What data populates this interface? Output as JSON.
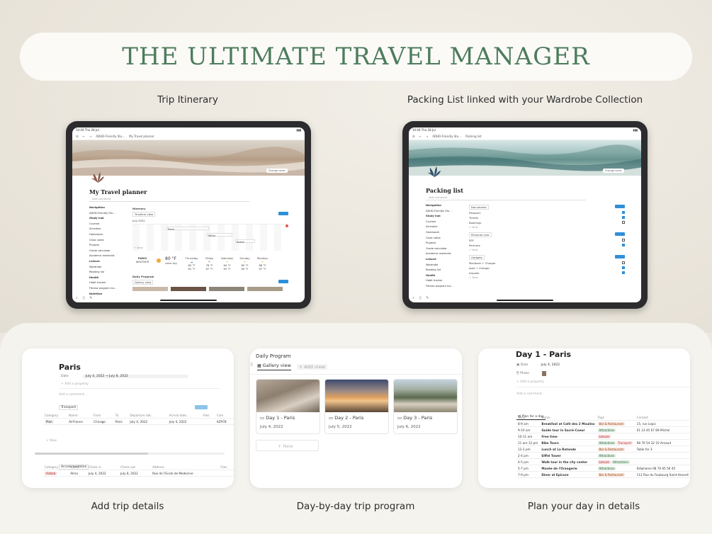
{
  "title": "THE ULTIMATE TRAVEL MANAGER",
  "captions": {
    "itinerary": "Trip Itinerary",
    "packing": "Packing List linked with your Wardrobe Collection",
    "trip_details": "Add trip details",
    "day_by_day": "Day-by-day trip program",
    "plan_day": "Plan your day in details"
  },
  "tablet_left": {
    "status_time": "10:04  Thu 28 Jul",
    "breadcrumb_1": "ADHD-Friendly Stu...",
    "breadcrumb_2": "My Travel planner",
    "change_cover": "Change cover",
    "page_title": "My Travel planner",
    "add_comment": "Add comment",
    "nav_heading": "Navigation",
    "nav_items": [
      "ADHD-Friendly Stu...",
      "Study hub",
      "Courses",
      "Schedule",
      "Homework",
      "Class notes",
      "Projects",
      "Grade calculator",
      "Academic materials",
      "Leisure",
      "Wardrobe",
      "Reading list",
      "Health",
      "Habit tracker",
      "Fitness program tra...",
      "Nutrition"
    ],
    "itinerary_label": "Itinerary",
    "timeline_view": "Timeline view",
    "month": "July 2022",
    "events": [
      "Paris",
      "Milan",
      "Rome"
    ],
    "new_label": "+ New",
    "weather_city": "PARIS",
    "weather_label": "WEATHER",
    "weather_temp": "80 °F",
    "weather_desc": "clear sky",
    "forecast": [
      {
        "day": "Thursday",
        "hi": "80 °F",
        "lo": "61 °F"
      },
      {
        "day": "Friday",
        "hi": "78 °F",
        "lo": "67 °F"
      },
      {
        "day": "Saturday",
        "hi": "84 °F",
        "lo": "63 °F"
      },
      {
        "day": "Sunday",
        "hi": "85 °F",
        "lo": "65 °F"
      },
      {
        "day": "Monday",
        "hi": "88 °F",
        "lo": "67 °F"
      }
    ],
    "daily_program": "Daily Program",
    "gallery_view": "Gallery view"
  },
  "tablet_right": {
    "status_time": "10:04  Thu 28 Jul",
    "breadcrumb_1": "ADHD-Friendly Stu...",
    "breadcrumb_2": "Packing list",
    "change_cover": "Change cover",
    "page_title": "Packing list",
    "add_comment": "Add comment",
    "nav_items": [
      "Navigation",
      "ADHD-Friendly Stu...",
      "Study hub",
      "Courses",
      "Schedule",
      "Homework",
      "Class notes",
      "Projects",
      "Grade calculator",
      "Academic materials",
      "Leisure",
      "Wardrobe",
      "Reading list",
      "Health",
      "Habit tracker",
      "Fitness program tra..."
    ],
    "groups": [
      {
        "name": "Documents",
        "items": [
          {
            "label": "Passport",
            "checked": true
          },
          {
            "label": "Tickets",
            "checked": true
          },
          {
            "label": "Bookings",
            "checked": false
          }
        ]
      },
      {
        "name": "Personal care",
        "items": [
          {
            "label": "SPF",
            "checked": false
          },
          {
            "label": "Perfume",
            "checked": true
          }
        ]
      },
      {
        "name": "Gadgets",
        "items": [
          {
            "label": "Macbook + Charger",
            "checked": false
          },
          {
            "label": "Ipad + Charger",
            "checked": true
          },
          {
            "label": "Airpods",
            "checked": true
          }
        ]
      }
    ],
    "new_label": "+ New"
  },
  "card_paris": {
    "title": "Paris",
    "date_label": "Date",
    "date_value": "July 4, 2022 → July 8, 2022",
    "add_property": "+ Add a property",
    "add_comment": "Add a comment...",
    "transport_tab": "Transport",
    "transport_headers": [
      "Category",
      "Name",
      "From",
      "To",
      "Departure dat...",
      "Arrival date...",
      "Files",
      "Com"
    ],
    "transport_row": [
      "Plan",
      "AirFrance",
      "Chicago",
      "Paris",
      "July 4, 2022",
      "July 4, 2022",
      "",
      "AZ978"
    ],
    "new_label": "+ New",
    "accommodation_tab": "Accommodation",
    "accom_headers": [
      "Category",
      "Name",
      "Check in",
      "Check out",
      "Address",
      "Files"
    ],
    "accom_row": [
      "Airbnb",
      "Alma",
      "July 4, 2022",
      "July 8, 2022",
      "Rue de l'Ecole de Medecine",
      ""
    ]
  },
  "card_program": {
    "title": "Daily Program",
    "gallery_view": "Gallery view",
    "add_view": "+ Add view",
    "days": [
      {
        "title": "Day 1 - Paris",
        "date": "July 4, 2022"
      },
      {
        "title": "Day 2 - Paris",
        "date": "July 5, 2022"
      },
      {
        "title": "Day 3 - Paris",
        "date": "July 6, 2022"
      }
    ],
    "new_label": "+ New"
  },
  "card_day": {
    "title": "Day 1 - Paris",
    "date_label": "Date",
    "date_value": "July 4, 2022",
    "photo_label": "Photo",
    "add_property": "+ Add a property",
    "add_comment": "Add a comment...",
    "plan_tab": "Plan for a day",
    "headers": [
      "Time",
      "Name",
      "Tags",
      "Contact"
    ],
    "rows": [
      {
        "time": "8-9 am",
        "name": "Breakfast at Café des 2 Moulins",
        "tags": [
          [
            "Bar & Restaurant",
            "bar"
          ]
        ],
        "contact": "15, rue Lepic"
      },
      {
        "time": "9-10 am",
        "name": "Guide tour in Sacré-Coeur",
        "tags": [
          [
            "Attractions",
            "attr"
          ]
        ],
        "contact": "01 23 45 67 89 Michel"
      },
      {
        "time": "10-11 am",
        "name": "Free time",
        "tags": [
          [
            "Leisure",
            "leis"
          ]
        ],
        "contact": ""
      },
      {
        "time": "11 am-12 pm",
        "name": "Bike Tours",
        "tags": [
          [
            "Attractions",
            "attr"
          ],
          [
            "Transport",
            "trans"
          ]
        ],
        "contact": "98 76 54 32 10 Arnaud"
      },
      {
        "time": "12-2 pm",
        "name": "Lunch at La Rotonde",
        "tags": [
          [
            "Bar & Restaurant",
            "bar"
          ]
        ],
        "contact": "Table for 3"
      },
      {
        "time": "2-4 pm",
        "name": "Eiffel Tower",
        "tags": [
          [
            "Attractions",
            "attr"
          ]
        ],
        "contact": ""
      },
      {
        "time": "4-5 pm",
        "name": "Walk tour in the city center",
        "tags": [
          [
            "Leisure",
            "leis"
          ],
          [
            "Attractions",
            "attr"
          ]
        ],
        "contact": ""
      },
      {
        "time": "5-7 pm",
        "name": "Musée de l'Orangerie",
        "tags": [
          [
            "Attractions",
            "attr"
          ]
        ],
        "contact": "Stéphanie 08 76 65 56 45"
      },
      {
        "time": "7-9 pm",
        "name": "Diner at Epicure",
        "tags": [
          [
            "Bar & Restaurant",
            "bar"
          ]
        ],
        "contact": "112 Rue du Faubourg Saint-Honoré"
      }
    ]
  },
  "colors": {
    "accent_green": "#4d7c5d",
    "notion_blue": "#2f8fd8"
  }
}
